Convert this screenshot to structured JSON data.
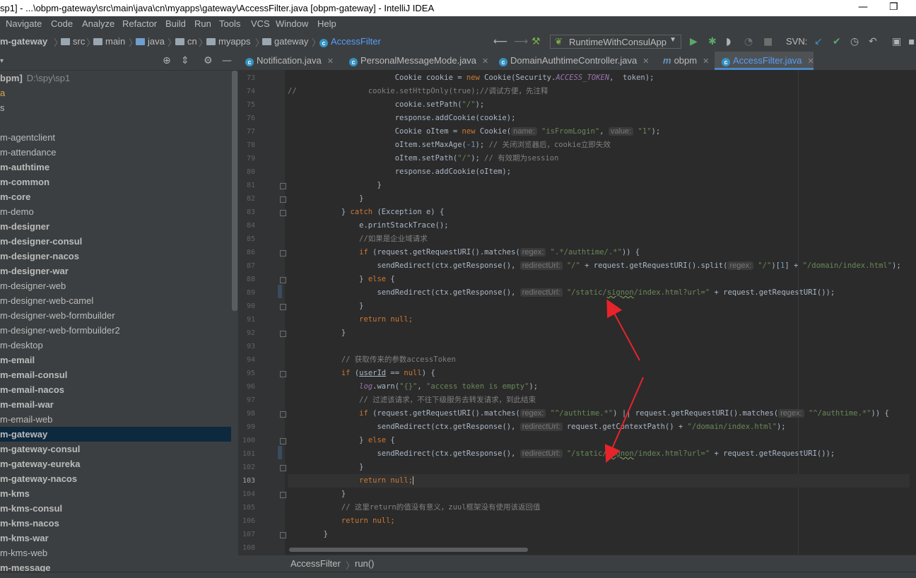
{
  "window": {
    "title": "sp1] - ...\\obpm-gateway\\src\\main\\java\\cn\\myapps\\gateway\\AccessFilter.java [obpm-gateway] - IntelliJ IDEA",
    "restore_glyph": "❐",
    "minimize_glyph": "—"
  },
  "menu": [
    "Navigate",
    "Code",
    "Analyze",
    "Refactor",
    "Build",
    "Run",
    "Tools",
    "VCS",
    "Window",
    "Help"
  ],
  "breadcrumbs": [
    "m-gateway",
    "src",
    "main",
    "java",
    "cn",
    "myapps",
    "gateway",
    "AccessFilter"
  ],
  "run_config": {
    "label": "RuntimeWithConsulApp"
  },
  "svn_label": "SVN:",
  "project": {
    "root_name": "bpm]",
    "root_path": "D:\\spy\\sp1",
    "items": [
      {
        "label": "a",
        "bold": false
      },
      {
        "label": "s",
        "bold": false
      },
      {
        "label": "",
        "bold": false
      },
      {
        "label": "m-agentclient",
        "bold": false
      },
      {
        "label": "m-attendance",
        "bold": false
      },
      {
        "label": "m-authtime",
        "bold": true
      },
      {
        "label": "m-common",
        "bold": true
      },
      {
        "label": "m-core",
        "bold": true
      },
      {
        "label": "m-demo",
        "bold": false
      },
      {
        "label": "m-designer",
        "bold": true
      },
      {
        "label": "m-designer-consul",
        "bold": true
      },
      {
        "label": "m-designer-nacos",
        "bold": true
      },
      {
        "label": "m-designer-war",
        "bold": true
      },
      {
        "label": "m-designer-web",
        "bold": false
      },
      {
        "label": "m-designer-web-camel",
        "bold": false
      },
      {
        "label": "m-designer-web-formbuilder",
        "bold": false
      },
      {
        "label": "m-designer-web-formbuilder2",
        "bold": false
      },
      {
        "label": "m-desktop",
        "bold": false
      },
      {
        "label": "m-email",
        "bold": true
      },
      {
        "label": "m-email-consul",
        "bold": true
      },
      {
        "label": "m-email-nacos",
        "bold": true
      },
      {
        "label": "m-email-war",
        "bold": true
      },
      {
        "label": "m-email-web",
        "bold": false
      },
      {
        "label": "m-gateway",
        "bold": true,
        "selected": true
      },
      {
        "label": "m-gateway-consul",
        "bold": true
      },
      {
        "label": "m-gateway-eureka",
        "bold": true
      },
      {
        "label": "m-gateway-nacos",
        "bold": true
      },
      {
        "label": "m-kms",
        "bold": true
      },
      {
        "label": "m-kms-consul",
        "bold": true
      },
      {
        "label": "m-kms-nacos",
        "bold": true
      },
      {
        "label": "m-kms-war",
        "bold": true
      },
      {
        "label": "m-kms-web",
        "bold": false
      },
      {
        "label": "m-message",
        "bold": true
      }
    ]
  },
  "tabs": [
    {
      "label": "Notification.java",
      "icon": "class-icon",
      "active": false
    },
    {
      "label": "PersonalMessageMode.java",
      "icon": "class-icon",
      "active": false
    },
    {
      "label": "DomainAuthtimeController.java",
      "icon": "class-icon",
      "active": false
    },
    {
      "label": "obpm",
      "icon": "maven-icon",
      "active": false
    },
    {
      "label": "AccessFilter.java",
      "icon": "class-icon",
      "active": true
    }
  ],
  "editor": {
    "line_numbers": [
      "73",
      "74",
      "75",
      "76",
      "77",
      "78",
      "79",
      "80",
      "81",
      "82",
      "83",
      "84",
      "85",
      "86",
      "87",
      "88",
      "89",
      "90",
      "91",
      "92",
      "93",
      "94",
      "95",
      "96",
      "97",
      "98",
      "99",
      "100",
      "101",
      "102",
      "103",
      "104",
      "105",
      "106",
      "107",
      "108"
    ],
    "current_line": "103",
    "hints": {
      "name": "name:",
      "value": "value:",
      "regex": "regex:",
      "redirectUrl": "redirectUrl:"
    },
    "strings": {
      "l73_a": "Cookie cookie = ",
      "l73_b": "new",
      "l73_c": " Cookie(Security.",
      "l73_d": "ACCESS_TOKEN",
      "l73_e": ",  token);",
      "l74_a": "//",
      "l74_b": "cookie.setHttpOnly(true);//调试方便，先注释",
      "l75": "cookie.setPath(",
      "l75_s": "\"/\"",
      "l75_e": ");",
      "l76": "response.addCookie(cookie);",
      "l77_a": "Cookie oItem = ",
      "l77_b": "new",
      "l77_c": " Cookie(",
      "l77_s1": "\"isFromLogin\"",
      "l77_comma": ", ",
      "l77_s2": "\"1\"",
      "l77_e": ");",
      "l78_a": "oItem.setMaxAge(",
      "l78_n": "-1",
      "l78_b": "); ",
      "l78_c": "// 关闭浏览器后，cookie立即失效",
      "l79_a": "oItem.setPath(",
      "l79_s": "\"/\"",
      "l79_b": "); ",
      "l79_c": "// 有效期为session",
      "l80": "response.addCookie(oItem);",
      "l81": "}",
      "l82": "}",
      "l83_a": "} ",
      "l83_b": "catch",
      "l83_c": " (Exception e) {",
      "l84": "e.printStackTrace();",
      "l85": "//如果是企业域请求",
      "l86_a": "if",
      "l86_b": " (request.getRequestURI().matches(",
      "l86_s": "\".*/authtime/.*\"",
      "l86_e": ")) {",
      "l87_a": "sendRedirect(ctx.getResponse(), ",
      "l87_s1": "\"/\"",
      "l87_b": " + request.getRequestURI().split(",
      "l87_s2": "\"/\"",
      "l87_c": ")[",
      "l87_n": "1",
      "l87_d": "] + ",
      "l87_s3": "\"/domain/index.html\"",
      "l87_e": ");",
      "l88_a": "} ",
      "l88_b": "else",
      "l88_c": " {",
      "l89_a": "sendRedirect(ctx.getResponse(), ",
      "l89_s1": "\"/static/",
      "l89_s2": "signon",
      "l89_s3": "/index.html?url=\"",
      "l89_b": " + request.getRequestURI());",
      "l90": "}",
      "l91_a": "return",
      "l91_b": " null",
      "l91_c": ";",
      "l92": "}",
      "l94": "// 获取传来的参数accessToken",
      "l95_a": "if",
      "l95_b": " (",
      "l95_c": "userId",
      "l95_d": " == ",
      "l95_e": "null",
      "l95_f": ") {",
      "l96_a": "log",
      "l96_b": ".warn(",
      "l96_s1": "\"{}\"",
      "l96_c": ", ",
      "l96_s2": "\"access token is empty\"",
      "l96_e": ");",
      "l97": "// 过滤该请求，不往下级服务去转发请求，到此结束",
      "l98_a": "if",
      "l98_b": " (request.getRequestURI().matches(",
      "l98_s1": "\"^/authtime.*\"",
      "l98_c": ") || request.getRequestURI().matches(",
      "l98_s2": "\"^/authtime.*\"",
      "l98_e": ")) {",
      "l99_a": "sendRedirect(ctx.getResponse(), ",
      "l99_b": "request.getContextPath() + ",
      "l99_s": "\"/domain/index.html\"",
      "l99_e": ");",
      "l100_a": "} ",
      "l100_b": "else",
      "l100_c": " {",
      "l101_a": "sendRedirect(ctx.getResponse(), ",
      "l101_s1": "\"/static/",
      "l101_s2": "signon",
      "l101_s3": "/index.html?url=\"",
      "l101_b": " + request.getRequestURI());",
      "l102": "}",
      "l103_a": "return",
      "l103_b": " null",
      "l103_c": ";",
      "l104": "}",
      "l105": "// 这里return的值没有意义，zuul框架没有使用该返回值",
      "l106_a": "return",
      "l106_b": " null",
      "l106_c": ";",
      "l107": "}"
    }
  },
  "status": {
    "class_crumb": "AccessFilter",
    "method_crumb": "run()"
  },
  "colors": {
    "annotation_arrow": "#e8232a",
    "selection": "#0d293e",
    "accent": "#589df6"
  }
}
